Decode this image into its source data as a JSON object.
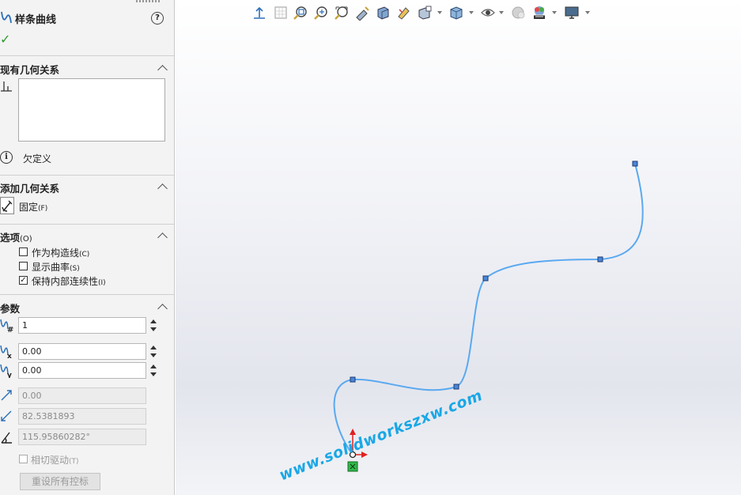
{
  "panel": {
    "title": "样条曲线",
    "help": "?",
    "sections": {
      "existing": {
        "title": "现有几何关系"
      },
      "status": {
        "text": "欠定义"
      },
      "add": {
        "title": "添加几何关系",
        "fix_label": "固定",
        "fix_shortcut": "(F)"
      },
      "options": {
        "title": "选项",
        "title_shortcut": "(O)",
        "items": [
          {
            "label": "作为构造线",
            "shortcut": "(C)",
            "checked": false
          },
          {
            "label": "显示曲率",
            "shortcut": "(S)",
            "checked": false
          },
          {
            "label": "保持内部连续性",
            "shortcut": "(I)",
            "checked": true
          }
        ]
      },
      "params": {
        "title": "参数",
        "point_number": "1",
        "x_coord": "0.00",
        "y_coord": "0.00",
        "tangent_weight_1": "0.00",
        "tangent_weight_2": "82.5381893",
        "tangent_angle": "115.95860282°",
        "tangent_driving_label": "相切驱动",
        "tangent_driving_shortcut": "(T)",
        "reset_button": "重设所有控标"
      }
    }
  },
  "toolbar": {
    "icons": [
      "view-orientation-icon",
      "sketch-grid-icon",
      "zoom-to-fit-icon",
      "zoom-area-icon",
      "zoom-selection-icon",
      "rotate-icon",
      "section-view-icon",
      "display-style-icon",
      "view-settings-icon",
      "standard-views-icon",
      "hide-show-icon",
      "appearance-icon",
      "scene-icon",
      "display-monitor-icon"
    ]
  },
  "canvas": {
    "watermark": "www.solidworkszxw.com",
    "spline_color": "#5aa9f0",
    "handle_color": "#4a86d8"
  }
}
